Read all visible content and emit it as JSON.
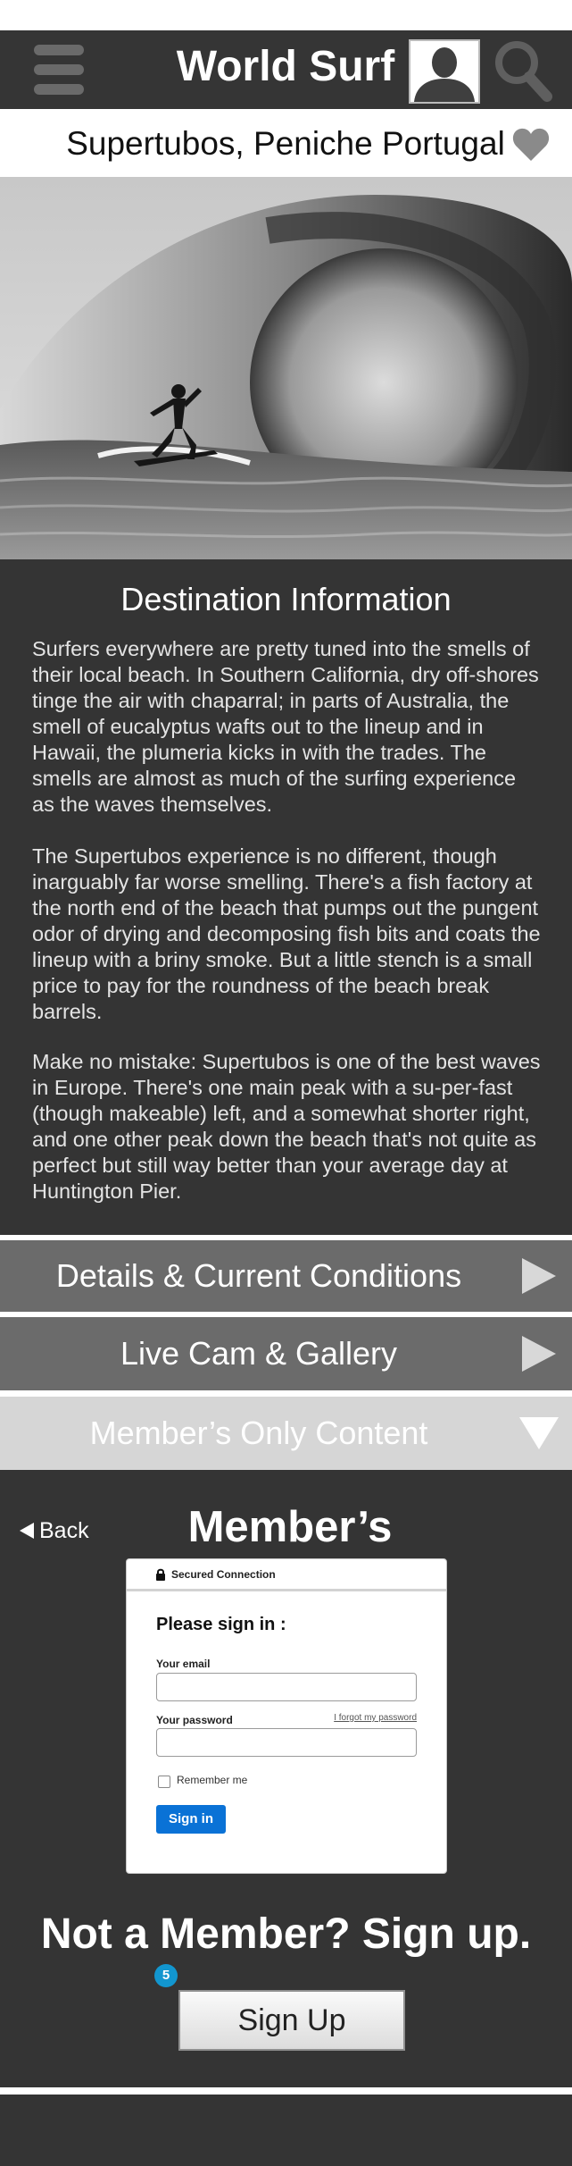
{
  "header": {
    "menu_icon": "hamburger-menu-icon",
    "title": "World Surf",
    "avatar_icon": "user-avatar-icon",
    "search_icon": "search-icon"
  },
  "location": {
    "title": "Supertubos, Peniche Portugal",
    "favorite_icon": "heart-icon"
  },
  "hero": {
    "image": "surfer-in-barrel-wave-photo"
  },
  "destination": {
    "heading": "Destination Information",
    "paragraphs": [
      "Surfers everywhere are pretty tuned into the smells of their local beach. In Southern California, dry off-shores tinge the air with chaparral; in parts of Australia, the smell of eucalyptus wafts out to the lineup and in Hawaii, the plumeria kicks in with the trades. The smells are almost as much of the surfing experience as the waves themselves.",
      "The Supertubos experience is no different, though inarguably far worse smelling. There's a fish factory at the north end of the beach that pumps out the pungent odor of drying and decomposing fish bits and coats the lineup with a briny smoke. But a little stench is a small price to pay for the roundness of the beach break barrels.",
      "Make no mistake: Supertubos is one of the best waves in Europe. There's one main peak with a su-per-fast (though makeable) left, and a somewhat shorter right, and one other peak down the beach that's not quite as perfect but still way better than your average day at Huntington Pier."
    ]
  },
  "accordion": {
    "details": {
      "label": "Details & Current Conditions",
      "icon": "triangle-right-icon"
    },
    "live_cam": {
      "label": "Live Cam & Gallery",
      "icon": "triangle-right-icon"
    },
    "members": {
      "label": "Member’s Only Content",
      "icon": "triangle-down-icon"
    }
  },
  "member_area": {
    "back_label": "Back",
    "login_title": "Member’s Login",
    "card": {
      "secure_label": "Secured Connection",
      "heading": "Please sign in :",
      "email_label": "Your email",
      "email_value": "",
      "password_label": "Your password",
      "password_value": "",
      "forgot_label": "I forgot my password",
      "remember_label": "Remember me",
      "signin_label": "Sign in"
    },
    "signup_heading": "Not a Member? Sign up.",
    "badge": "5",
    "signup_label": "Sign Up"
  },
  "colors": {
    "dark_panel": "#343434",
    "accordion_dark": "#6b6b6b",
    "accordion_light": "#d6d6d6",
    "signin_blue": "#0a72d6",
    "badge_blue": "#1296cf"
  }
}
